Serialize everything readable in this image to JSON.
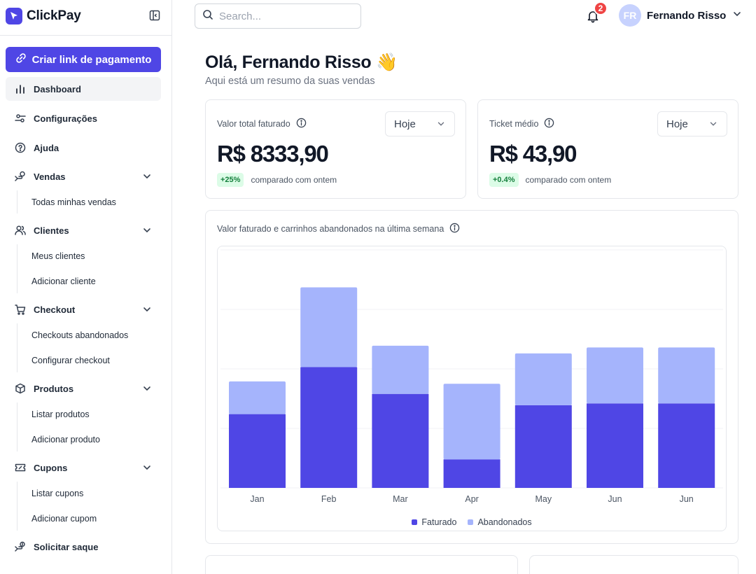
{
  "brand": {
    "name": "ClickPay"
  },
  "sidebar": {
    "cta_label": "Criar link de pagamento",
    "nav": [
      {
        "label": "Dashboard",
        "icon": "bar-chart-icon"
      },
      {
        "label": "Configurações",
        "icon": "sliders-icon"
      },
      {
        "label": "Ajuda",
        "icon": "help-circle-icon"
      },
      {
        "label": "Vendas",
        "icon": "sales-icon",
        "sub": [
          "Todas minhas vendas"
        ]
      },
      {
        "label": "Clientes",
        "icon": "users-icon",
        "sub": [
          "Meus clientes",
          "Adicionar cliente"
        ]
      },
      {
        "label": "Checkout",
        "icon": "cart-icon",
        "sub": [
          "Checkouts abandonados",
          "Configurar checkout"
        ]
      },
      {
        "label": "Produtos",
        "icon": "box-icon",
        "sub": [
          "Listar produtos",
          "Adicionar produto"
        ]
      },
      {
        "label": "Cupons",
        "icon": "ticket-icon",
        "sub": [
          "Listar cupons",
          "Adicionar cupom"
        ]
      },
      {
        "label": "Solicitar saque",
        "icon": "withdraw-icon"
      }
    ]
  },
  "header": {
    "search_placeholder": "Search...",
    "notifications_count": "2",
    "user_initials": "FR",
    "user_name": "Fernando Risso"
  },
  "greeting": {
    "title": "Olá, Fernando Risso 👋",
    "subtitle": "Aqui está um resumo da suas vendas"
  },
  "cards": [
    {
      "label": "Valor total faturado",
      "period": "Hoje",
      "value": "R$ 8333,90",
      "delta": "+25%",
      "compare": "comparado com ontem"
    },
    {
      "label": "Ticket médio",
      "period": "Hoje",
      "value": "R$ 43,90",
      "delta": "+0.4%",
      "compare": "comparado com ontem"
    }
  ],
  "chart_section": {
    "title": "Valor faturado e carrinhos abandonados na última semana"
  },
  "colors": {
    "accent": "#4f46e5",
    "faturado": "#4f46e5",
    "abandonados": "#a5b4fc",
    "badge": "#ef4444"
  },
  "chart_data": {
    "type": "bar",
    "stacked": true,
    "categories": [
      "Jan",
      "Feb",
      "Mar",
      "Apr",
      "May",
      "Jun",
      "Jun"
    ],
    "series": [
      {
        "name": "Faturado",
        "values": [
          124,
          203,
          158,
          48,
          139,
          142,
          142
        ]
      },
      {
        "name": "Abandonados",
        "values": [
          55,
          134,
          81,
          127,
          87,
          94,
          94
        ]
      }
    ],
    "ylim": [
      0,
      400
    ],
    "grid": true,
    "legend": "bottom"
  }
}
